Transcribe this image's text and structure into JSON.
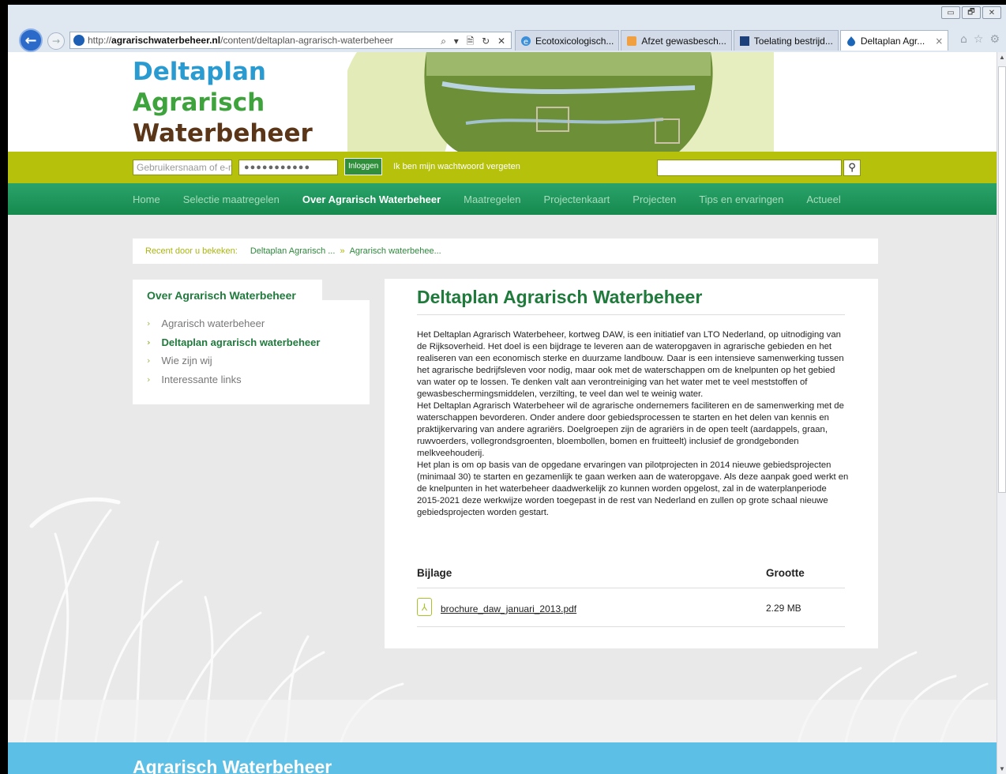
{
  "browser": {
    "url_prefix": "http://",
    "url_domain": "agrarischwaterbeheer.nl",
    "url_path": "/content/deltaplan-agrarisch-waterbeheer",
    "address_tools": "⌕ ▾ 🗎 ↻ ✕",
    "tabs": [
      {
        "label": "Ecotoxicologisch...",
        "icon": "ie-icon",
        "active": false
      },
      {
        "label": "Afzet gewasbesch...",
        "icon": "page-icon",
        "active": false
      },
      {
        "label": "Toelating bestrijd...",
        "icon": "ctgb-icon",
        "active": false
      },
      {
        "label": "Deltaplan Agr...",
        "icon": "drupal-icon",
        "active": true
      }
    ],
    "tab_close": "×",
    "window_controls": [
      "▭",
      "🗗",
      "✕"
    ],
    "right_icons": [
      "⌂",
      "☆",
      "⚙"
    ]
  },
  "header": {
    "logo_line1": "Deltaplan",
    "logo_line2": "Agrarisch",
    "logo_line3": "Waterbeheer"
  },
  "login": {
    "username_placeholder": "Gebruikersnaam of e-mail",
    "password_masked": "●●●●●●●●●●●",
    "login_button": "Inloggen",
    "forgot_link": "Ik ben mijn wachtwoord vergeten",
    "search_value": "",
    "search_icon": "search-icon"
  },
  "nav": {
    "items": [
      {
        "label": "Home",
        "active": false
      },
      {
        "label": "Selectie maatregelen",
        "active": false
      },
      {
        "label": "Over Agrarisch Waterbeheer",
        "active": true
      },
      {
        "label": "Maatregelen",
        "active": false
      },
      {
        "label": "Projectenkaart",
        "active": false
      },
      {
        "label": "Projecten",
        "active": false
      },
      {
        "label": "Tips en ervaringen",
        "active": false
      },
      {
        "label": "Actueel",
        "active": false
      }
    ]
  },
  "breadcrumb": {
    "label": "Recent door u bekeken:",
    "item1": "Deltaplan Agrarisch ...",
    "separator": "»",
    "item2": "Agrarisch waterbehee..."
  },
  "sidebar": {
    "title": "Over Agrarisch Waterbeheer",
    "chevron": "›",
    "items": [
      {
        "label": "Agrarisch waterbeheer",
        "active": false
      },
      {
        "label": "Deltaplan agrarisch waterbeheer",
        "active": true
      },
      {
        "label": "Wie zijn wij",
        "active": false
      },
      {
        "label": "Interessante links",
        "active": false
      }
    ]
  },
  "content": {
    "title": "Deltaplan Agrarisch Waterbeheer",
    "paragraph1": "Het Deltaplan Agrarisch Waterbeheer, kortweg DAW, is een initiatief van LTO Nederland, op uitnodiging van de Rijksoverheid. Het doel is een bijdrage te leveren aan de wateropgaven in agrarische gebieden en het realiseren van een economisch sterke en duurzame landbouw. Daar is een intensieve samenwerking tussen het agrarische bedrijfsleven voor nodig, maar ook met de waterschappen om de knelpunten op het gebied van water op te lossen. Te denken valt aan verontreiniging van het water met te veel meststoffen of gewasbeschermingsmiddelen, verzilting, te veel dan wel te weinig water.",
    "paragraph2": "Het Deltaplan Agrarisch Waterbeheer wil de agrarische ondernemers faciliteren en de samenwerking met de waterschappen bevorderen. Onder andere door gebiedsprocessen te starten en het delen van kennis en praktijkervaring van andere agrariërs. Doelgroepen zijn de agrariërs in de open teelt (aardappels, graan, ruwvoerders, vollegrondsgroenten, bloembollen, bomen en fruitteelt) inclusief de grondgebonden melkveehouderij.",
    "paragraph3": "Het plan is om op basis van de opgedane ervaringen van pilotprojecten in 2014 nieuwe gebiedsprojecten (minimaal 30) te starten en gezamenlijk te gaan werken aan de wateropgave. Als deze aanpak goed werkt en de knelpunten in het waterbeheer daadwerkelijk zo kunnen worden opgelost, zal in de waterplanperiode 2015-2021 deze werkwijze worden toegepast in de rest van Nederland en zullen op grote schaal nieuwe gebiedsprojecten worden gestart.",
    "attachments": {
      "header_name": "Bijlage",
      "header_size": "Grootte",
      "file_name": "brochure_daw_januari_2013.pdf",
      "file_size": "2.29 MB",
      "file_icon": "pdf-icon"
    }
  },
  "footer": {
    "title": "Agrarisch Waterbeheer"
  },
  "colors": {
    "logo_blue": "#2a9bd1",
    "logo_green": "#3ea33c",
    "logo_brown": "#5a3517",
    "lime_bar": "#b5c10a",
    "nav_green": "#1a9058",
    "heading_green": "#1f7a3c",
    "footer_blue": "#5bbfe6"
  }
}
